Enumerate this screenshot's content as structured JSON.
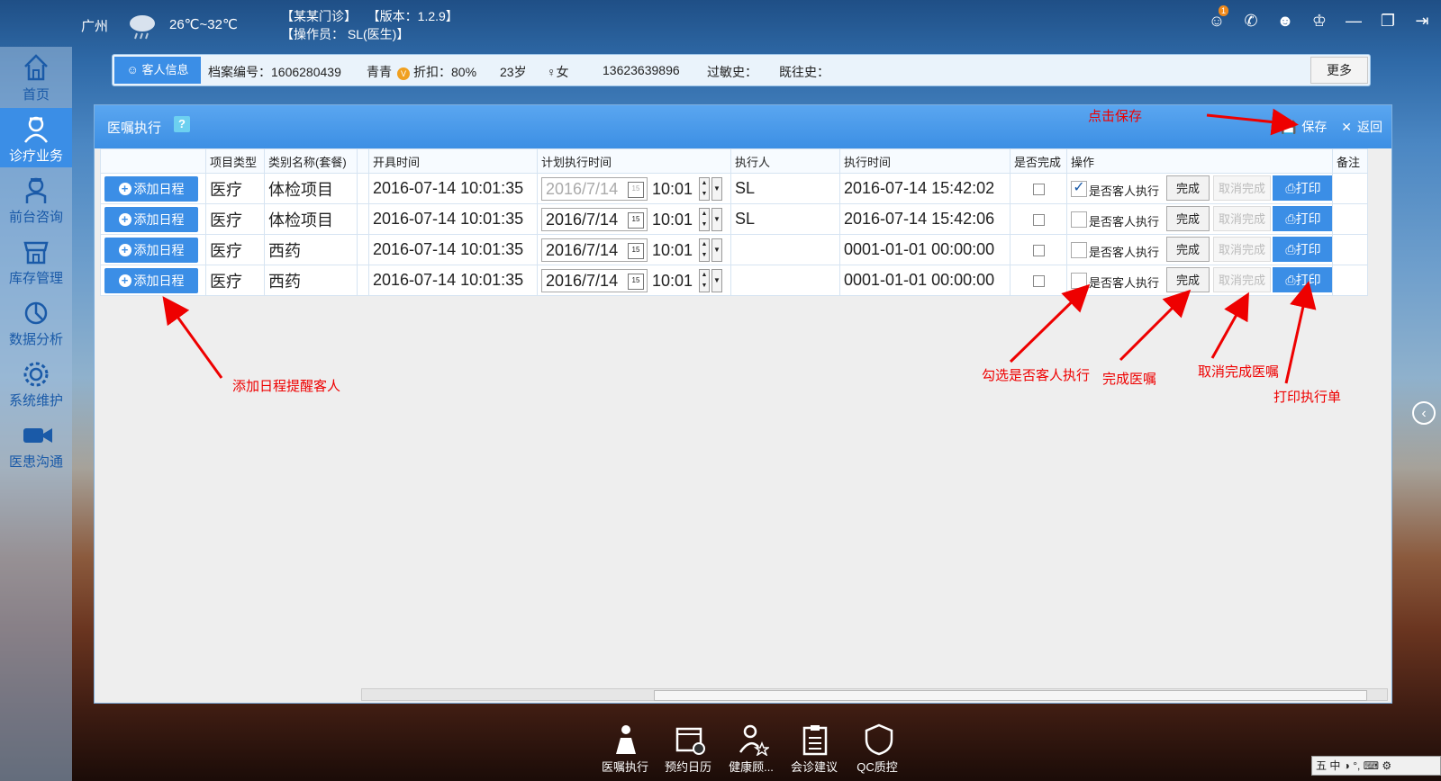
{
  "header": {
    "city": "广州",
    "weather_icon": "cloud-rain-icon",
    "temperature": "26℃~32℃",
    "clinic": "【某某门诊】",
    "version": "【版本：1.2.9】",
    "operator": "【操作员： SL(医生)】",
    "notification_count": "1"
  },
  "sidebar": {
    "items": [
      {
        "label": "首页",
        "icon": "home-icon"
      },
      {
        "label": "诊疗业务",
        "icon": "doctor-icon"
      },
      {
        "label": "前台咨询",
        "icon": "nurse-icon"
      },
      {
        "label": "库存管理",
        "icon": "store-icon"
      },
      {
        "label": "数据分析",
        "icon": "pie-chart-icon"
      },
      {
        "label": "系统维护",
        "icon": "gear-icon"
      },
      {
        "label": "医患沟通",
        "icon": "video-icon"
      }
    ]
  },
  "infobar": {
    "tab_label": "客人信息",
    "file_no": "档案编号：1606280439",
    "name": "青青",
    "vip": "V",
    "discount": "折扣：80%",
    "age": "23岁",
    "gender": "♀女",
    "phone": "13623639896",
    "allergy": "过敏史：",
    "history": "既往史：",
    "more": "更多"
  },
  "panel": {
    "title": "医嘱执行",
    "help": "?",
    "save": "保存",
    "back": "返回",
    "columns": [
      "",
      "项目类型",
      "类别名称(套餐)",
      "",
      "开具时间",
      "计划执行时间",
      "执行人",
      "执行时间",
      "是否完成",
      "操作",
      "备注"
    ],
    "add_label": "添加日程",
    "op_checkbox_label": "是否客人执行",
    "done_label": "完成",
    "cancel_done_label": "取消完成",
    "print_label": "打印",
    "rows": [
      {
        "type": "医疗",
        "name": "体检项目",
        "issued": "2016-07-14 10:01:35",
        "plan_date": "2016/7/14",
        "plan_time": "10:01",
        "executor": "SL",
        "exec_time": "2016-07-14 15:42:02",
        "client_exec": true,
        "disabled": true
      },
      {
        "type": "医疗",
        "name": "体检项目",
        "issued": "2016-07-14 10:01:35",
        "plan_date": "2016/7/14",
        "plan_time": "10:01",
        "executor": "SL",
        "exec_time": "2016-07-14 15:42:06",
        "client_exec": false,
        "disabled": false
      },
      {
        "type": "医疗",
        "name": "西药",
        "issued": "2016-07-14 10:01:35",
        "plan_date": "2016/7/14",
        "plan_time": "10:01",
        "executor": "",
        "exec_time": "0001-01-01 00:00:00",
        "client_exec": false,
        "disabled": false
      },
      {
        "type": "医疗",
        "name": "西药",
        "issued": "2016-07-14 10:01:35",
        "plan_date": "2016/7/14",
        "plan_time": "10:01",
        "executor": "",
        "exec_time": "0001-01-01 00:00:00",
        "client_exec": false,
        "disabled": false
      }
    ]
  },
  "annotations": {
    "save_hint": "点击保存",
    "add_hint": "添加日程提醒客人",
    "check_hint": "勾选是否客人执行",
    "done_hint": "完成医嘱",
    "cancel_hint": "取消完成医嘱",
    "print_hint": "打印执行单"
  },
  "dock": {
    "items": [
      {
        "label": "医嘱执行",
        "icon": "order-exec-icon"
      },
      {
        "label": "预约日历",
        "icon": "calendar-icon"
      },
      {
        "label": "健康顾...",
        "icon": "advisor-icon"
      },
      {
        "label": "会诊建议",
        "icon": "clipboard-icon"
      },
      {
        "label": "QC质控",
        "icon": "qc-shield-icon"
      }
    ]
  },
  "tray": {
    "text": "五 中 ◑ °, ⌨ ⚙"
  },
  "colors": {
    "accent": "#3b8ee6",
    "annotation": "#e00000"
  }
}
